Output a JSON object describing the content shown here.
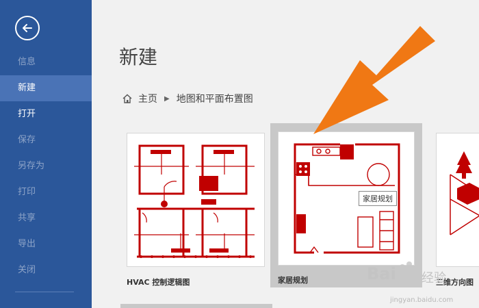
{
  "colors": {
    "sidebar": "#2b579a",
    "active_item": "#4a73b6",
    "drawing_red": "#c00000",
    "arrow": "#f07814"
  },
  "sidebar": {
    "back_icon": "back-arrow-icon",
    "items": [
      {
        "label": "信息",
        "enabled": false
      },
      {
        "label": "新建",
        "enabled": true,
        "active": true
      },
      {
        "label": "打开",
        "enabled": true
      },
      {
        "label": "保存",
        "enabled": false
      },
      {
        "label": "另存为",
        "enabled": false
      },
      {
        "label": "打印",
        "enabled": false
      },
      {
        "label": "共享",
        "enabled": false
      },
      {
        "label": "导出",
        "enabled": false
      },
      {
        "label": "关闭",
        "enabled": false
      }
    ]
  },
  "main": {
    "title": "新建",
    "breadcrumb": {
      "home": "主页",
      "current": "地图和平面布置图"
    },
    "templates": [
      {
        "label": "HVAC 控制逻辑图"
      },
      {
        "label": "家居规划",
        "tooltip": "家居规划"
      },
      {
        "label": "三维方向图"
      }
    ]
  },
  "watermark": {
    "brand": "Bai",
    "suffix": "经验",
    "url": "jingyan.baidu.com"
  }
}
